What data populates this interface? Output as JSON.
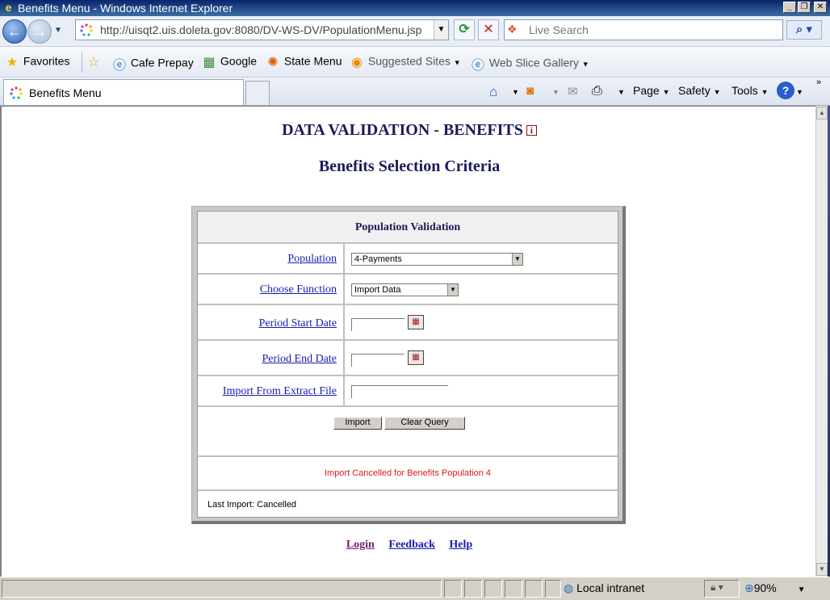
{
  "window": {
    "title": "Benefits Menu - Windows Internet Explorer",
    "controls": {
      "minimize": "_",
      "maximize": "❐",
      "close": "✕"
    }
  },
  "address": {
    "url": "http://uisqt2.uis.doleta.gov:8080/DV-WS-DV/PopulationMenu.jsp",
    "search_placeholder": "Live Search"
  },
  "favorites": {
    "label": "Favorites",
    "items": [
      {
        "label": "Cafe Prepay"
      },
      {
        "label": "Google"
      },
      {
        "label": "State Menu"
      },
      {
        "label": "Suggested Sites"
      },
      {
        "label": "Web Slice Gallery"
      }
    ]
  },
  "tabs": [
    {
      "label": "Benefits Menu"
    }
  ],
  "commands": {
    "page": "Page",
    "safety": "Safety",
    "tools": "Tools"
  },
  "page": {
    "title": "DATA VALIDATION - BENEFITS",
    "info_glyph": "i",
    "subtitle": "Benefits Selection Criteria",
    "panel_header": "Population Validation",
    "fields": {
      "population": {
        "label": "Population",
        "value": "4-Payments"
      },
      "function": {
        "label": "Choose Function",
        "value": "Import Data"
      },
      "start_date": {
        "label": "Period Start Date",
        "value": ""
      },
      "end_date": {
        "label": "Period End Date",
        "value": ""
      },
      "extract_file": {
        "label": "Import From Extract File",
        "value": ""
      }
    },
    "buttons": {
      "import": "Import",
      "clear": "Clear Query"
    },
    "message": "Import Cancelled for Benefits Population 4",
    "last_import": "Last Import: Cancelled",
    "footer_links": {
      "login": "Login",
      "feedback": "Feedback",
      "help": "Help"
    }
  },
  "status": {
    "zone": "Local intranet",
    "zoom": "90%"
  },
  "colors": {
    "heading": "#1a1a5a",
    "link": "#1a1ab0",
    "message": "#e01818"
  }
}
